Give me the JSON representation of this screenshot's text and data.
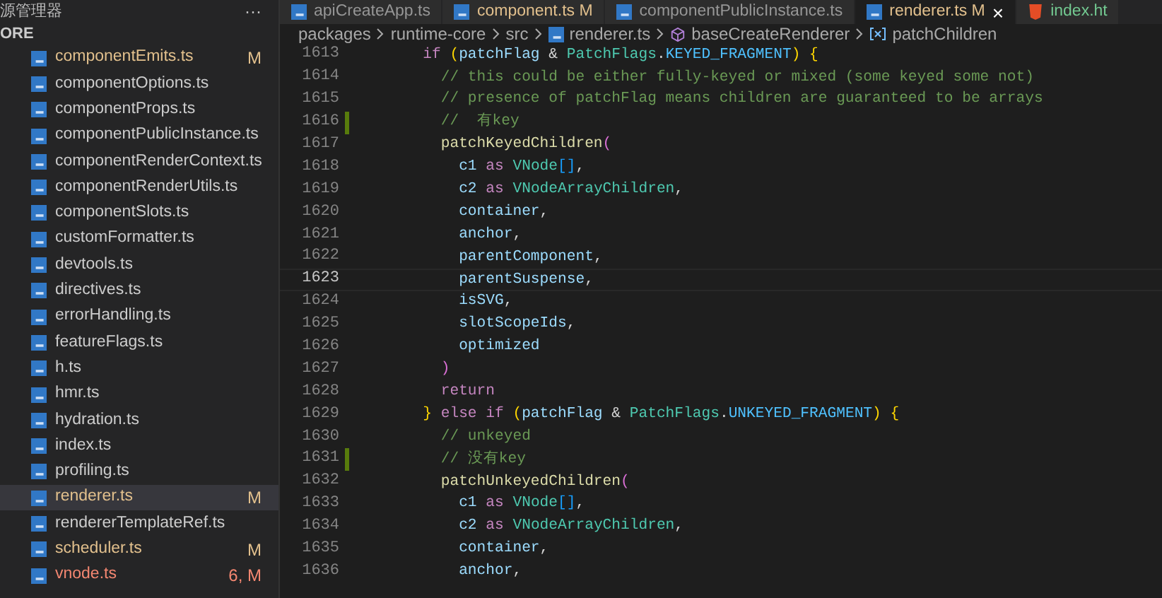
{
  "sidebar": {
    "title": "源管理器",
    "more": "···",
    "section": "ORE",
    "files": [
      {
        "name": "componentEmits.ts",
        "status": "M",
        "kind": "modified",
        "selected": false
      },
      {
        "name": "componentOptions.ts",
        "kind": "clean",
        "selected": false
      },
      {
        "name": "componentProps.ts",
        "kind": "clean",
        "selected": false
      },
      {
        "name": "componentPublicInstance.ts",
        "kind": "clean",
        "selected": false
      },
      {
        "name": "componentRenderContext.ts",
        "kind": "clean",
        "selected": false
      },
      {
        "name": "componentRenderUtils.ts",
        "kind": "clean",
        "selected": false
      },
      {
        "name": "componentSlots.ts",
        "kind": "clean",
        "selected": false
      },
      {
        "name": "customFormatter.ts",
        "kind": "clean",
        "selected": false
      },
      {
        "name": "devtools.ts",
        "kind": "clean",
        "selected": false
      },
      {
        "name": "directives.ts",
        "kind": "clean",
        "selected": false
      },
      {
        "name": "errorHandling.ts",
        "kind": "clean",
        "selected": false
      },
      {
        "name": "featureFlags.ts",
        "kind": "clean",
        "selected": false
      },
      {
        "name": "h.ts",
        "kind": "clean",
        "selected": false
      },
      {
        "name": "hmr.ts",
        "kind": "clean",
        "selected": false
      },
      {
        "name": "hydration.ts",
        "kind": "clean",
        "selected": false
      },
      {
        "name": "index.ts",
        "kind": "clean",
        "selected": false
      },
      {
        "name": "profiling.ts",
        "kind": "clean",
        "selected": false
      },
      {
        "name": "renderer.ts",
        "status": "M",
        "kind": "modified",
        "selected": true
      },
      {
        "name": "rendererTemplateRef.ts",
        "kind": "clean",
        "selected": false
      },
      {
        "name": "scheduler.ts",
        "status": "M",
        "kind": "modified",
        "selected": false
      },
      {
        "name": "vnode.ts",
        "status": "6, M",
        "kind": "error",
        "selected": false
      }
    ]
  },
  "tabs": [
    {
      "label": "apiCreateApp.ts",
      "html": false,
      "kind": "clean",
      "selected": false
    },
    {
      "label": "component.ts",
      "status": "M",
      "html": false,
      "kind": "modified",
      "selected": false
    },
    {
      "label": "componentPublicInstance.ts",
      "html": false,
      "kind": "clean",
      "selected": false
    },
    {
      "label": "renderer.ts",
      "status": "M",
      "html": false,
      "kind": "modified",
      "selected": true,
      "close": "×"
    },
    {
      "label": "index.ht",
      "html": true,
      "kind": "untracked",
      "selected": false
    }
  ],
  "breadcrumb": [
    {
      "label": "packages",
      "kind": "folder"
    },
    {
      "label": "runtime-core",
      "kind": "folder"
    },
    {
      "label": "src",
      "kind": "folder"
    },
    {
      "label": "renderer.ts",
      "kind": "file"
    },
    {
      "label": "baseCreateRenderer",
      "kind": "method"
    },
    {
      "label": "patchChildren",
      "kind": "variable"
    }
  ],
  "code": [
    {
      "number": "1613",
      "current": false,
      "changed": false,
      "tokens": [
        {
          "kind": "kw",
          "text": "      if "
        },
        {
          "kind": "b1",
          "text": "("
        },
        {
          "kind": "var",
          "text": "patchFlag"
        },
        {
          "kind": "p",
          "text": " & "
        },
        {
          "kind": "type",
          "text": "PatchFlags"
        },
        {
          "kind": "p",
          "text": "."
        },
        {
          "kind": "const",
          "text": "KEYED_FRAGMENT"
        },
        {
          "kind": "b1",
          "text": ") {"
        }
      ]
    },
    {
      "number": "1614",
      "current": false,
      "changed": false,
      "tokens": [
        {
          "kind": "cmt",
          "text": "        // this could be either fully-keyed or mixed (some keyed some not)"
        }
      ]
    },
    {
      "number": "1615",
      "current": false,
      "changed": false,
      "tokens": [
        {
          "kind": "cmt",
          "text": "        // presence of patchFlag means children are guaranteed to be arrays"
        }
      ]
    },
    {
      "number": "1616",
      "current": false,
      "changed": true,
      "tokens": [
        {
          "kind": "cmt",
          "text": "        //  有key"
        }
      ]
    },
    {
      "number": "1617",
      "current": false,
      "changed": false,
      "tokens": [
        {
          "kind": "fn",
          "text": "        patchKeyedChildren"
        },
        {
          "kind": "b2",
          "text": "("
        }
      ]
    },
    {
      "number": "1618",
      "current": false,
      "changed": false,
      "tokens": [
        {
          "kind": "var",
          "text": "          c1 "
        },
        {
          "kind": "kw",
          "text": "as "
        },
        {
          "kind": "type",
          "text": "VNode"
        },
        {
          "kind": "b3",
          "text": "[]"
        },
        {
          "kind": "p",
          "text": ","
        }
      ]
    },
    {
      "number": "1619",
      "current": false,
      "changed": false,
      "tokens": [
        {
          "kind": "var",
          "text": "          c2 "
        },
        {
          "kind": "kw",
          "text": "as "
        },
        {
          "kind": "type",
          "text": "VNodeArrayChildren"
        },
        {
          "kind": "p",
          "text": ","
        }
      ]
    },
    {
      "number": "1620",
      "current": false,
      "changed": false,
      "tokens": [
        {
          "kind": "var",
          "text": "          container"
        },
        {
          "kind": "p",
          "text": ","
        }
      ]
    },
    {
      "number": "1621",
      "current": false,
      "changed": false,
      "tokens": [
        {
          "kind": "var",
          "text": "          anchor"
        },
        {
          "kind": "p",
          "text": ","
        }
      ]
    },
    {
      "number": "1622",
      "current": false,
      "changed": false,
      "tokens": [
        {
          "kind": "var",
          "text": "          parentComponent"
        },
        {
          "kind": "p",
          "text": ","
        }
      ]
    },
    {
      "number": "1623",
      "current": true,
      "changed": false,
      "tokens": [
        {
          "kind": "var",
          "text": "          parentSuspense"
        },
        {
          "kind": "p",
          "text": ","
        }
      ]
    },
    {
      "number": "1624",
      "current": false,
      "changed": false,
      "tokens": [
        {
          "kind": "var",
          "text": "          isSVG"
        },
        {
          "kind": "p",
          "text": ","
        }
      ]
    },
    {
      "number": "1625",
      "current": false,
      "changed": false,
      "tokens": [
        {
          "kind": "var",
          "text": "          slotScopeIds"
        },
        {
          "kind": "p",
          "text": ","
        }
      ]
    },
    {
      "number": "1626",
      "current": false,
      "changed": false,
      "tokens": [
        {
          "kind": "var",
          "text": "          optimized"
        }
      ]
    },
    {
      "number": "1627",
      "current": false,
      "changed": false,
      "tokens": [
        {
          "kind": "b2",
          "text": "        )"
        }
      ]
    },
    {
      "number": "1628",
      "current": false,
      "changed": false,
      "tokens": [
        {
          "kind": "kw",
          "text": "        return"
        }
      ]
    },
    {
      "number": "1629",
      "current": false,
      "changed": false,
      "tokens": [
        {
          "kind": "b1",
          "text": "      } "
        },
        {
          "kind": "kw",
          "text": "else if "
        },
        {
          "kind": "b1",
          "text": "("
        },
        {
          "kind": "var",
          "text": "patchFlag"
        },
        {
          "kind": "p",
          "text": " & "
        },
        {
          "kind": "type",
          "text": "PatchFlags"
        },
        {
          "kind": "p",
          "text": "."
        },
        {
          "kind": "const",
          "text": "UNKEYED_FRAGMENT"
        },
        {
          "kind": "b1",
          "text": ") {"
        }
      ]
    },
    {
      "number": "1630",
      "current": false,
      "changed": false,
      "tokens": [
        {
          "kind": "cmt",
          "text": "        // unkeyed"
        }
      ]
    },
    {
      "number": "1631",
      "current": false,
      "changed": true,
      "tokens": [
        {
          "kind": "cmt",
          "text": "        // 没有key"
        }
      ]
    },
    {
      "number": "1632",
      "current": false,
      "changed": false,
      "tokens": [
        {
          "kind": "fn",
          "text": "        patchUnkeyedChildren"
        },
        {
          "kind": "b2",
          "text": "("
        }
      ]
    },
    {
      "number": "1633",
      "current": false,
      "changed": false,
      "tokens": [
        {
          "kind": "var",
          "text": "          c1 "
        },
        {
          "kind": "kw",
          "text": "as "
        },
        {
          "kind": "type",
          "text": "VNode"
        },
        {
          "kind": "b3",
          "text": "[]"
        },
        {
          "kind": "p",
          "text": ","
        }
      ]
    },
    {
      "number": "1634",
      "current": false,
      "changed": false,
      "tokens": [
        {
          "kind": "var",
          "text": "          c2 "
        },
        {
          "kind": "kw",
          "text": "as "
        },
        {
          "kind": "type",
          "text": "VNodeArrayChildren"
        },
        {
          "kind": "p",
          "text": ","
        }
      ]
    },
    {
      "number": "1635",
      "current": false,
      "changed": false,
      "tokens": [
        {
          "kind": "var",
          "text": "          container"
        },
        {
          "kind": "p",
          "text": ","
        }
      ]
    },
    {
      "number": "1636",
      "current": false,
      "changed": false,
      "tokens": [
        {
          "kind": "var",
          "text": "          anchor"
        },
        {
          "kind": "p",
          "text": ","
        }
      ]
    }
  ]
}
